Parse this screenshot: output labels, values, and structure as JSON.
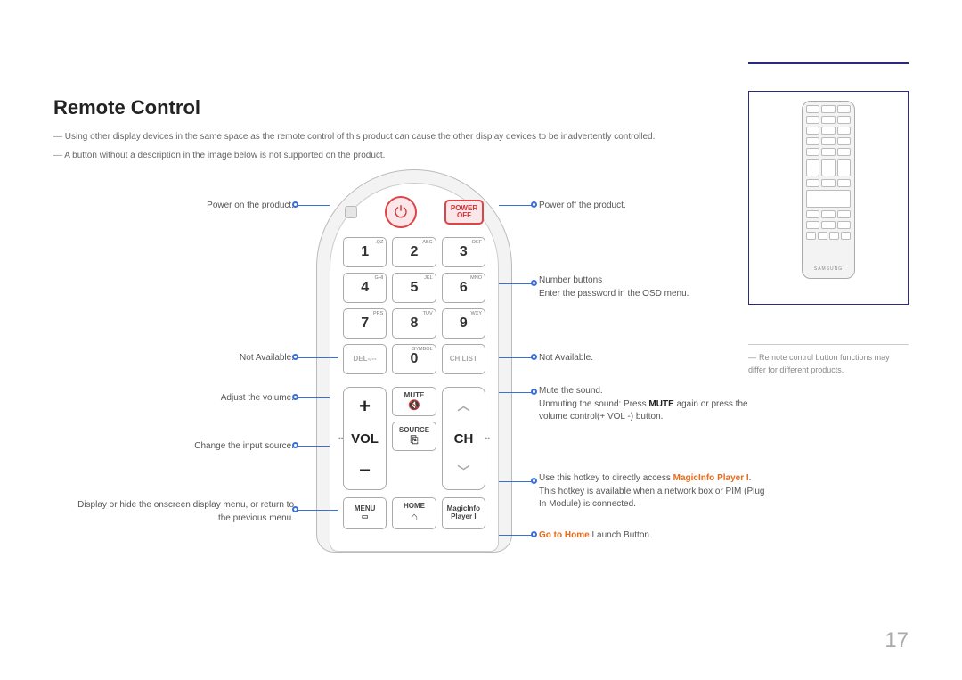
{
  "page": {
    "title": "Remote Control",
    "note1": "Using other display devices in the same space as the remote control of this product can cause the other display devices to be inadvertently controlled.",
    "note2": "A button without a description in the image below is not supported on the product.",
    "pagenum": "17"
  },
  "remote": {
    "power_off_line1": "POWER",
    "power_off_line2": "OFF",
    "keys": {
      "k1": "1",
      "k1s": ".QZ",
      "k2": "2",
      "k2s": "ABC",
      "k3": "3",
      "k3s": "DEF",
      "k4": "4",
      "k4s": "GHI",
      "k5": "5",
      "k5s": "JKL",
      "k6": "6",
      "k6s": "MNO",
      "k7": "7",
      "k7s": "PRS",
      "k8": "8",
      "k8s": "TUV",
      "k9": "9",
      "k9s": "WXY",
      "k0": "0",
      "k0s": "SYMBOL",
      "del": "DEL-/--",
      "chlist": "CH LIST"
    },
    "vol": "VOL",
    "ch": "CH",
    "mute": "MUTE",
    "source": "SOURCE",
    "menu": "MENU",
    "home": "HOME",
    "magic_l1": "MagicInfo",
    "magic_l2": "Player I"
  },
  "labels": {
    "power_on": "Power on the product.",
    "power_off": "Power off the product.",
    "number_l1": "Number buttons",
    "number_l2": "Enter the password in the OSD menu.",
    "na_left": "Not Available.",
    "na_right": "Not Available.",
    "volume": "Adjust the volume.",
    "mute_l1": "Mute the sound.",
    "mute_l2a": "Unmuting the sound: Press ",
    "mute_l2b": "MUTE",
    "mute_l2c": " again or press the volume control(+ VOL -) button.",
    "src": "Change the input source.",
    "menu": "Display or hide the onscreen display menu, or return to the previous menu.",
    "magic_l1a": "Use this hotkey to directly access ",
    "magic_l1b": "MagicInfo Player I",
    "magic_l1c": ".",
    "magic_l2": "This hotkey is available when a network box or PIM (Plug In Module) is connected.",
    "home_a": "Go to Home",
    "home_b": " Launch Button."
  },
  "side": {
    "note": "Remote control button functions may differ for different products.",
    "brand": "SAMSUNG"
  }
}
